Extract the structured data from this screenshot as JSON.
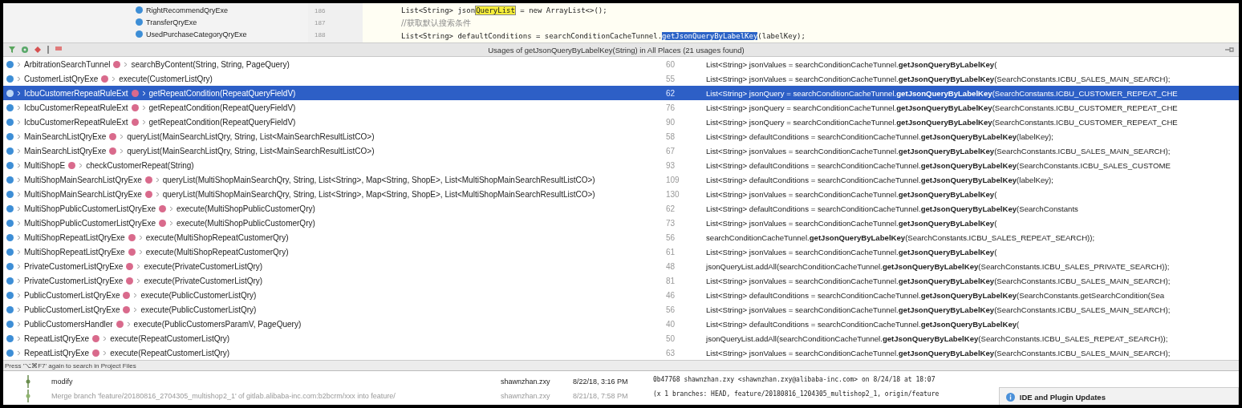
{
  "editor": {
    "tree_items": [
      "RightRecommendQryExe",
      "TransferQryExe",
      "UsedPurchaseCategoryQryExe"
    ],
    "lines": [
      {
        "number": "186",
        "segments": [
          {
            "kind": "plain",
            "text": "List<String> json"
          },
          {
            "kind": "highlight",
            "text": "QueryList"
          },
          {
            "kind": "plain",
            "text": " = new ArrayList<>();"
          }
        ]
      },
      {
        "number": "187",
        "segments": [
          {
            "kind": "comment",
            "text": "//获取默认搜索条件"
          }
        ]
      },
      {
        "number": "188",
        "segments": [
          {
            "kind": "plain",
            "text": "List<String> defaultConditions = searchConditionCacheTunnel."
          },
          {
            "kind": "selection",
            "text": "getJsonQueryByLabelKey"
          },
          {
            "kind": "plain",
            "text": "(labelKey);"
          }
        ]
      }
    ]
  },
  "usages_panel": {
    "title": "Usages of getJsonQueryByLabelKey(String) in All Places (21 usages found)",
    "rows": [
      {
        "class": "ArbitrationSearchTunnel",
        "method": "searchByContent(String, String, PageQuery)",
        "line": "60",
        "code": "List<String> jsonValues = searchConditionCacheTunnel.**getJsonQueryByLabelKey**(",
        "selected": false
      },
      {
        "class": "CustomerListQryExe",
        "method": "execute(CustomerListQry)",
        "line": "55",
        "code": "List<String> jsonValues = searchConditionCacheTunnel.**getJsonQueryByLabelKey**(SearchConstants.ICBU_SALES_MAIN_SEARCH);",
        "selected": false
      },
      {
        "class": "IcbuCustomerRepeatRuleExt",
        "method": "getRepeatCondition(RepeatQueryFieldV)",
        "line": "62",
        "code": "List<String> jsonQuery = searchConditionCacheTunnel.**getJsonQueryByLabelKey**(SearchConstants.ICBU_CUSTOMER_REPEAT_CHE",
        "selected": true
      },
      {
        "class": "IcbuCustomerRepeatRuleExt",
        "method": "getRepeatCondition(RepeatQueryFieldV)",
        "line": "76",
        "code": "List<String> jsonQuery = searchConditionCacheTunnel.**getJsonQueryByLabelKey**(SearchConstants.ICBU_CUSTOMER_REPEAT_CHE",
        "selected": false
      },
      {
        "class": "IcbuCustomerRepeatRuleExt",
        "method": "getRepeatCondition(RepeatQueryFieldV)",
        "line": "90",
        "code": "List<String> jsonQuery = searchConditionCacheTunnel.**getJsonQueryByLabelKey**(SearchConstants.ICBU_CUSTOMER_REPEAT_CHE",
        "selected": false
      },
      {
        "class": "MainSearchListQryExe",
        "method": "queryList(MainSearchListQry, String, List<MainSearchResultListCO>)",
        "line": "58",
        "code": "List<String> defaultConditions = searchConditionCacheTunnel.**getJsonQueryByLabelKey**(labelKey);",
        "selected": false
      },
      {
        "class": "MainSearchListQryExe",
        "method": "queryList(MainSearchListQry, String, List<MainSearchResultListCO>)",
        "line": "67",
        "code": "List<String> jsonValues = searchConditionCacheTunnel.**getJsonQueryByLabelKey**(SearchConstants.ICBU_SALES_MAIN_SEARCH);",
        "selected": false
      },
      {
        "class": "MultiShopE",
        "method": "checkCustomerRepeat(String)",
        "line": "93",
        "code": "List<String> defaultConditions = searchConditionCacheTunnel.**getJsonQueryByLabelKey**(SearchConstants.ICBU_SALES_CUSTOME",
        "selected": false
      },
      {
        "class": "MultiShopMainSearchListQryExe",
        "method": "queryList(MultiShopMainSearchQry, String, List<String>, Map<String, ShopE>, List<MultiShopMainSearchResultListCO>)",
        "line": "109",
        "code": "List<String> defaultConditions = searchConditionCacheTunnel.**getJsonQueryByLabelKey**(labelKey);",
        "selected": false
      },
      {
        "class": "MultiShopMainSearchListQryExe",
        "method": "queryList(MultiShopMainSearchQry, String, List<String>, Map<String, ShopE>, List<MultiShopMainSearchResultListCO>)",
        "line": "130",
        "code": "List<String> jsonValues = searchConditionCacheTunnel.**getJsonQueryByLabelKey**(",
        "selected": false
      },
      {
        "class": "MultiShopPublicCustomerListQryExe",
        "method": "execute(MultiShopPublicCustomerQry)",
        "line": "62",
        "code": "List<String> defaultConditions = searchConditionCacheTunnel.**getJsonQueryByLabelKey**(SearchConstants",
        "selected": false
      },
      {
        "class": "MultiShopPublicCustomerListQryExe",
        "method": "execute(MultiShopPublicCustomerQry)",
        "line": "73",
        "code": "List<String> jsonValues = searchConditionCacheTunnel.**getJsonQueryByLabelKey**(",
        "selected": false
      },
      {
        "class": "MultiShopRepeatListQryExe",
        "method": "execute(MultiShopRepeatCustomerQry)",
        "line": "56",
        "code": "searchConditionCacheTunnel.**getJsonQueryByLabelKey**(SearchConstants.ICBU_SALES_REPEAT_SEARCH));",
        "selected": false
      },
      {
        "class": "MultiShopRepeatListQryExe",
        "method": "execute(MultiShopRepeatCustomerQry)",
        "line": "61",
        "code": "List<String> jsonValues = searchConditionCacheTunnel.**getJsonQueryByLabelKey**(",
        "selected": false
      },
      {
        "class": "PrivateCustomerListQryExe",
        "method": "execute(PrivateCustomerListQry)",
        "line": "48",
        "code": "jsonQueryList.addAll(searchConditionCacheTunnel.**getJsonQueryByLabelKey**(SearchConstants.ICBU_SALES_PRIVATE_SEARCH));",
        "selected": false
      },
      {
        "class": "PrivateCustomerListQryExe",
        "method": "execute(PrivateCustomerListQry)",
        "line": "81",
        "code": "List<String> jsonValues = searchConditionCacheTunnel.**getJsonQueryByLabelKey**(SearchConstants.ICBU_SALES_MAIN_SEARCH);",
        "selected": false
      },
      {
        "class": "PublicCustomerListQryExe",
        "method": "execute(PublicCustomerListQry)",
        "line": "46",
        "code": "List<String> defaultConditions = searchConditionCacheTunnel.**getJsonQueryByLabelKey**(SearchConstants.getSearchCondition(Sea",
        "selected": false
      },
      {
        "class": "PublicCustomerListQryExe",
        "method": "execute(PublicCustomerListQry)",
        "line": "56",
        "code": "List<String> jsonValues = searchConditionCacheTunnel.**getJsonQueryByLabelKey**(SearchConstants.ICBU_SALES_MAIN_SEARCH);",
        "selected": false
      },
      {
        "class": "PublicCustomersHandler",
        "method": "execute(PublicCustomersParamV, PageQuery)",
        "line": "40",
        "code": "List<String> defaultConditions = searchConditionCacheTunnel.**getJsonQueryByLabelKey**(",
        "selected": false
      },
      {
        "class": "RepeatListQryExe",
        "method": "execute(RepeatCustomerListQry)",
        "line": "50",
        "code": "jsonQueryList.addAll(searchConditionCacheTunnel.**getJsonQueryByLabelKey**(SearchConstants.ICBU_SALES_REPEAT_SEARCH));",
        "selected": false
      },
      {
        "class": "RepeatListQryExe",
        "method": "execute(RepeatCustomerListQry)",
        "line": "63",
        "code": "List<String> jsonValues = searchConditionCacheTunnel.**getJsonQueryByLabelKey**(SearchConstants.ICBU_SALES_MAIN_SEARCH);",
        "selected": false
      }
    ],
    "hint": "Press '⌥⌘F7' again to search in Project Files"
  },
  "vcs_log": {
    "commits": [
      {
        "message": "modify",
        "author": "shawnzhan.zxy",
        "date": "8/22/18, 3:16 PM",
        "merge": false
      },
      {
        "message": "Merge branch 'feature/20180816_2704305_multishop2_1' of gitlab.alibaba-inc.com:b2bcrm/xxx into feature/",
        "author": "shawnzhan.zxy",
        "date": "8/21/18, 7:58 PM",
        "merge": true
      }
    ],
    "details": [
      "0b47768 shawnzhan.zxy <shawnzhan.zxy@alibaba-inc.com> on 8/24/18 at 18:07",
      "(x 1 branches: HEAD, feature/20180816_1204305_multishop2_1, origin/feature"
    ]
  },
  "notification": {
    "title": "IDE and Plugin Updates"
  }
}
